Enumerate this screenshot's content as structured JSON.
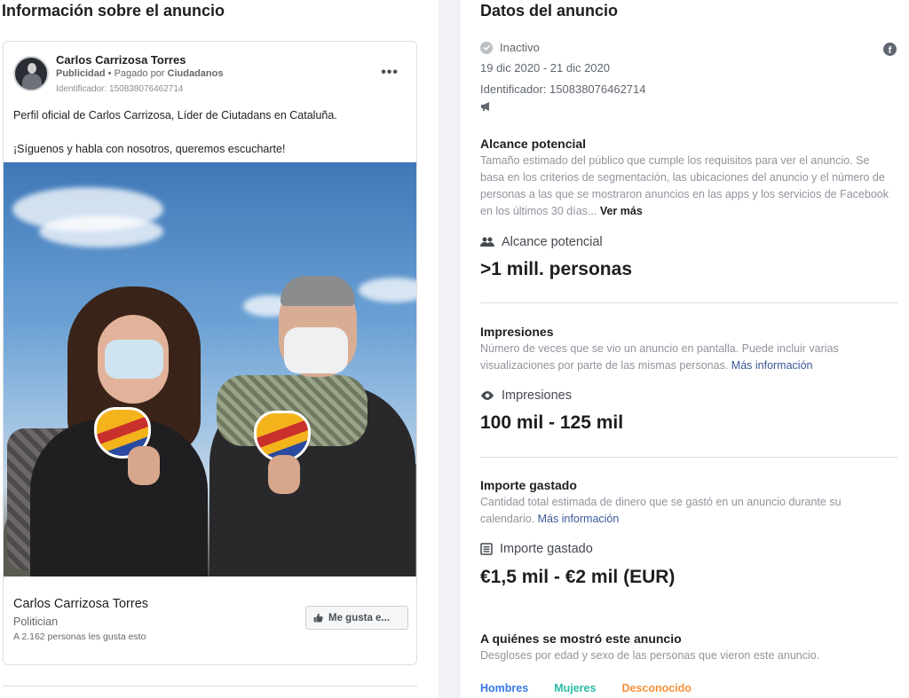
{
  "left": {
    "title": "Información sobre el anuncio",
    "ad": {
      "author": "Carlos Carrizosa Torres",
      "sponsored": "Publicidad",
      "paid_prefix": " • Pagado por ",
      "paid_by": "Ciudadanos",
      "identifier": "Identificador: 150838076462714",
      "more_icon": "more-dots-icon",
      "text_line1": "Perfil oficial de Carlos Carrizosa, Líder de Ciutadans en Cataluña.",
      "text_line2": "¡Síguenos y habla con nosotros, queremos escucharte!",
      "page_name": "Carlos Carrizosa Torres",
      "page_category": "Politician",
      "page_likes": "A 2.162 personas les gusta esto",
      "like_button": "Me gusta e..."
    }
  },
  "right": {
    "title": "Datos del anuncio",
    "status": "Inactivo",
    "dates": "19 dic 2020 - 21 dic 2020",
    "identifier": "Identificador: 150838076462714",
    "platform_icon": "facebook-icon",
    "reach": {
      "title": "Alcance potencial",
      "desc": "Tamaño estimado del público que cumple los requisitos para ver el anuncio. Se basa en los criterios de segmentación, las ubicaciones del anuncio y el número de personas a las que se mostraron anuncios en las apps y los servicios de Facebook en los últimos 30 días...",
      "more": "Ver más",
      "label": "Alcance potencial",
      "value": ">1 mill. personas"
    },
    "impressions": {
      "title": "Impresiones",
      "desc": "Número de veces que se vio un anuncio en pantalla. Puede incluir varias visualizaciones por parte de las mismas personas.",
      "link": "Más información",
      "label": "Impresiones",
      "value": "100 mil - 125 mil"
    },
    "spend": {
      "title": "Importe gastado",
      "desc": "Cantidad total estimada de dinero que se gastó en un anuncio durante su calendario.",
      "link": "Más información",
      "label": "Importe gastado",
      "value": "€1,5 mil - €2 mil (EUR)"
    },
    "audience": {
      "title": "A quiénes se mostró este anuncio",
      "desc": "Desgloses por edad y sexo de las personas que vieron este anuncio.",
      "legend": [
        {
          "label": "Hombres",
          "color": "#3578e5"
        },
        {
          "label": "Mujeres",
          "color": "#2abba7"
        },
        {
          "label": "Desconocido",
          "color": "#f7923b"
        }
      ]
    }
  }
}
